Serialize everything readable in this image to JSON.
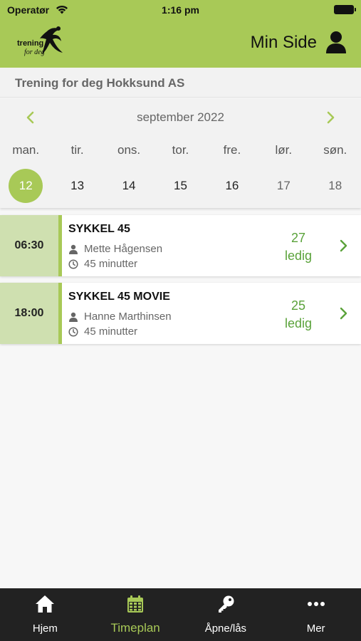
{
  "status": {
    "carrier": "Operatør",
    "time": "1:16 pm"
  },
  "header": {
    "logo_text": "trening for deg",
    "min_side": "Min Side"
  },
  "gym": {
    "title": "Trening for deg Hokksund AS"
  },
  "calendar": {
    "month": "september 2022",
    "weekdays": [
      "man.",
      "tir.",
      "ons.",
      "tor.",
      "fre.",
      "lør.",
      "søn."
    ],
    "days": [
      "12",
      "13",
      "14",
      "15",
      "16",
      "17",
      "18"
    ],
    "selected_day": "12"
  },
  "sessions": [
    {
      "time": "06:30",
      "name": "SYKKEL 45",
      "instructor": "Mette Hågensen",
      "duration": "45 minutter",
      "available_count": "27",
      "available_label": "ledig"
    },
    {
      "time": "18:00",
      "name": "SYKKEL 45 MOVIE",
      "instructor": "Hanne Marthinsen",
      "duration": "45 minutter",
      "available_count": "25",
      "available_label": "ledig"
    }
  ],
  "tabs": [
    {
      "label": "Hjem",
      "icon": "home-icon"
    },
    {
      "label": "Timeplan",
      "icon": "calendar-icon",
      "active": true
    },
    {
      "label": "Åpne/lås",
      "icon": "key-icon"
    },
    {
      "label": "Mer",
      "icon": "more-icon"
    }
  ],
  "colors": {
    "brand_green": "#a8c957",
    "available_green": "#5aa23a",
    "tabbar": "#222222"
  }
}
